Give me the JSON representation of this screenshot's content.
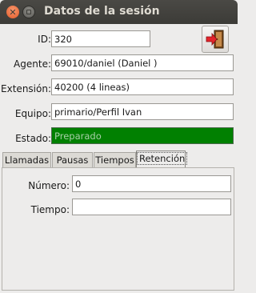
{
  "window": {
    "title": "Datos de la sesión"
  },
  "session": {
    "id_label": "ID:",
    "id_value": "320",
    "agent_label": "Agente:",
    "agent_value": "69010/daniel (Daniel )",
    "extension_label": "Extensión:",
    "extension_value": "40200 (4 lineas)",
    "team_label": "Equipo:",
    "team_value": "primario/Perfil Ivan",
    "status_label": "Estado:",
    "status_value": "Preparado"
  },
  "tabs": [
    {
      "label": "Llamadas"
    },
    {
      "label": "Pausas"
    },
    {
      "label": "Tiempos"
    },
    {
      "label": "Retención"
    }
  ],
  "retention": {
    "number_label": "Número:",
    "number_value": "0",
    "time_label": "Tiempo:",
    "time_value": ""
  },
  "colors": {
    "status_ok": "#018001",
    "title_bar": "#3c3b37",
    "close_button": "#e35b2a"
  },
  "icons": {
    "logout": "logout-door-icon"
  }
}
